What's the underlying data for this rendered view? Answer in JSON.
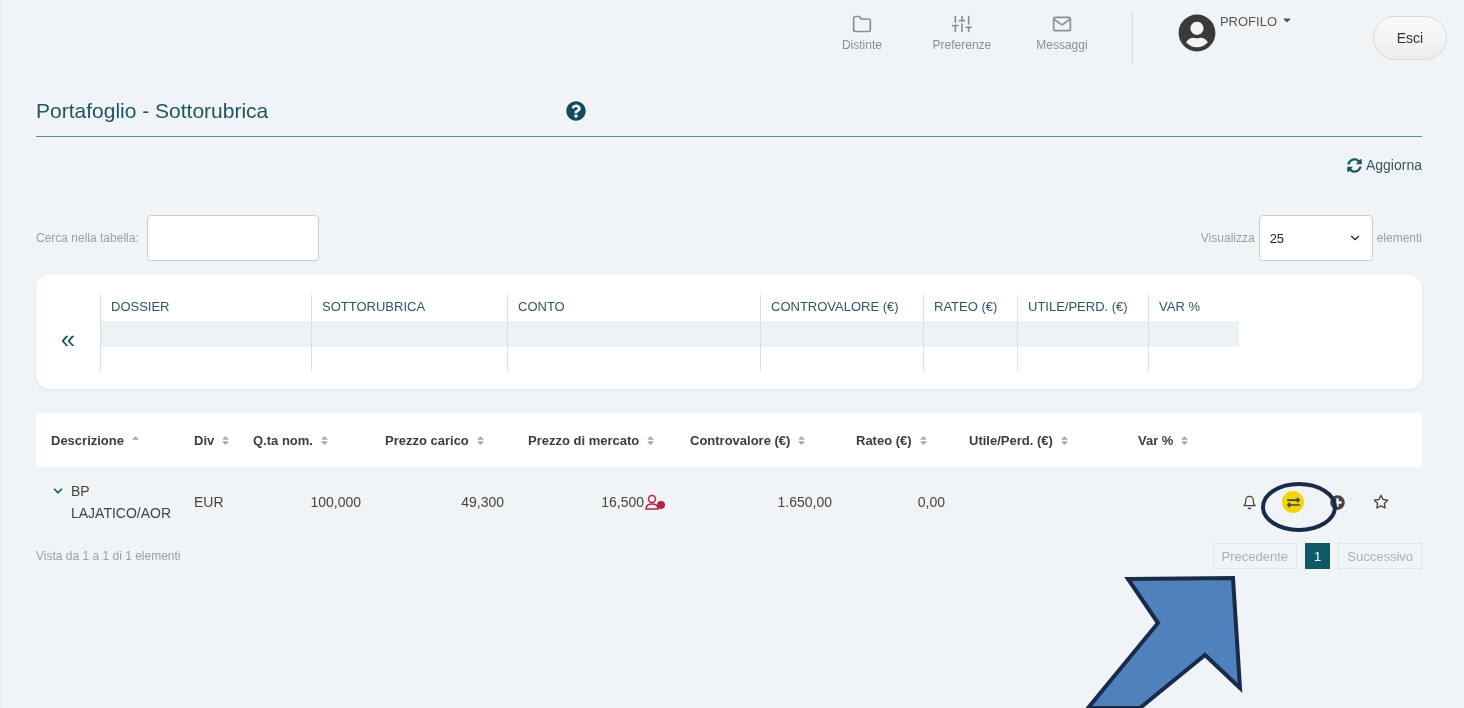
{
  "top_nav": [
    {
      "kind": "folder",
      "label": "Distinte"
    },
    {
      "kind": "sliders",
      "label": "Preferenze"
    },
    {
      "kind": "mail",
      "label": "Messaggi"
    }
  ],
  "profile": {
    "label": "PROFILO"
  },
  "logout_button": "Esci",
  "page_title": "Portafoglio - Sottorubrica",
  "refresh": "Aggiorna",
  "search": {
    "label": "Cerca nella tabella:"
  },
  "page_size": {
    "prefix": "Visualizza",
    "value": "25",
    "suffix": "elementi"
  },
  "collapse_button": "«",
  "summary": {
    "columns": [
      "DOSSIER",
      "SOTTORUBRICA",
      "CONTO",
      "CONTROVALORE (€)",
      "RATEO (€)",
      "UTILE/PERD. (€)",
      "VAR %"
    ]
  },
  "table": {
    "columns": [
      {
        "label": "Descrizione",
        "sorted_ascending": true
      },
      {
        "label": "Div",
        "sorted_ascending": false
      },
      {
        "label": "Q.ta nom.",
        "sorted_ascending": false
      },
      {
        "label": "Prezzo carico",
        "sorted_ascending": false
      },
      {
        "label": "Prezzo di mercato",
        "sorted_ascending": false
      },
      {
        "label": "Controvalore (€)",
        "sorted_ascending": false
      },
      {
        "label": "Rateo (€)",
        "sorted_ascending": false
      },
      {
        "label": "Utile/Perd. (€)",
        "sorted_ascending": false
      },
      {
        "label": "Var %",
        "sorted_ascending": false
      }
    ],
    "rows": [
      {
        "cells": [
          "BP LAJATICO/AOR",
          "EUR",
          "100,000",
          "49,300",
          "16,500",
          "1.650,00",
          "0,00"
        ],
        "actions": [
          {
            "kind": "bell",
            "highlighted": false
          },
          {
            "kind": "exchange",
            "highlighted": true
          },
          {
            "kind": "plus",
            "highlighted": false
          },
          {
            "kind": "star",
            "highlighted": false
          }
        ]
      }
    ]
  },
  "info": "Vista da 1 a 1 di 1 elementi",
  "pagination": [
    {
      "label": "Precedente",
      "selected": false,
      "disabled": true
    },
    {
      "label": "1",
      "selected": true,
      "disabled": false
    },
    {
      "label": "Successivo",
      "selected": false,
      "disabled": true
    }
  ]
}
